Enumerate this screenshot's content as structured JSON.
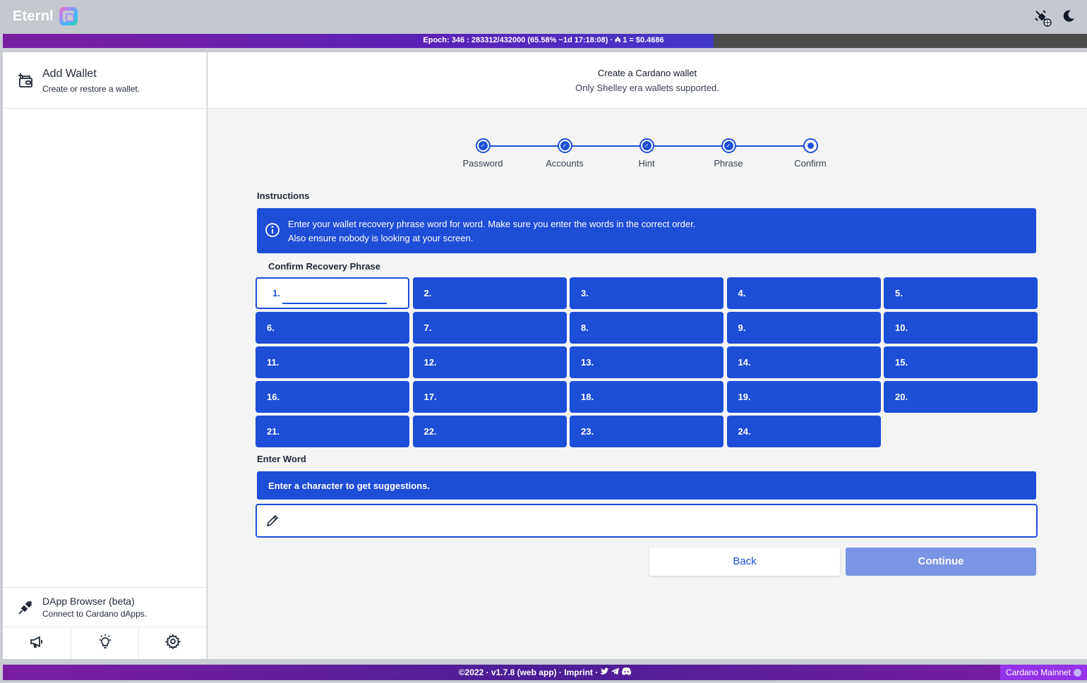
{
  "app": {
    "name": "Eternl"
  },
  "epoch_bar": {
    "text": "Epoch: 346 : 283312/432000 (65.58% ~1d 17:18:08) · ₳ 1 = $0.4686",
    "progress": 0.6558
  },
  "sidebar": {
    "add_wallet": {
      "title": "Add Wallet",
      "subtitle": "Create or restore a wallet."
    },
    "dapp_browser": {
      "title": "DApp Browser (beta)",
      "subtitle": "Connect to Cardano dApps."
    },
    "bottom_icons": [
      "megaphone-icon",
      "lightbulb-icon",
      "gear-icon"
    ]
  },
  "header": {
    "title": "Create a Cardano wallet",
    "subtitle": "Only Shelley era wallets supported."
  },
  "stepper": {
    "steps": [
      {
        "label": "Password",
        "state": "done"
      },
      {
        "label": "Accounts",
        "state": "done"
      },
      {
        "label": "Hint",
        "state": "done"
      },
      {
        "label": "Phrase",
        "state": "done"
      },
      {
        "label": "Confirm",
        "state": "current"
      }
    ]
  },
  "instructions": {
    "heading": "Instructions",
    "line1": "Enter your wallet recovery phrase word for word. Make sure you enter the words in the correct order.",
    "line2": "Also ensure nobody is looking at your screen."
  },
  "confirm_phrase": {
    "heading": "Confirm Recovery Phrase",
    "words": [
      "1.",
      "2.",
      "3.",
      "4.",
      "5.",
      "6.",
      "7.",
      "8.",
      "9.",
      "10.",
      "11.",
      "12.",
      "13.",
      "14.",
      "15.",
      "16.",
      "17.",
      "18.",
      "19.",
      "20.",
      "21.",
      "22.",
      "23.",
      "24."
    ],
    "active_index": 0
  },
  "enter_word": {
    "heading": "Enter Word",
    "suggestion_text": "Enter a character to get suggestions.",
    "value": ""
  },
  "buttons": {
    "back": "Back",
    "continue": "Continue"
  },
  "footer": {
    "text": "©2022 · v1.7.8 (web app) · Imprint ·",
    "network": "Cardano Mainnet"
  },
  "colors": {
    "accent": "#1d4ed8",
    "continue_disabled": "#7a95e3",
    "brand_purple": "#7b1fa2"
  }
}
